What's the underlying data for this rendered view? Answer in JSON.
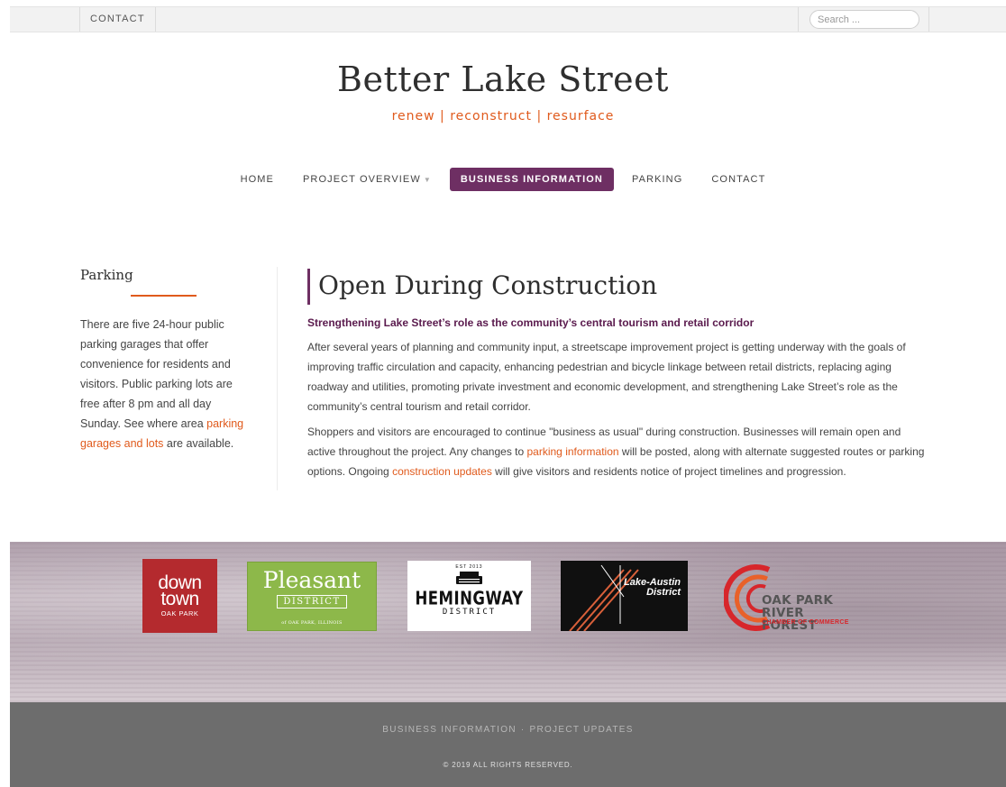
{
  "topbar": {
    "contact_label": "CONTACT",
    "search_placeholder": "Search ..."
  },
  "header": {
    "site_title": "Better Lake Street",
    "tagline": "renew | reconstruct | resurface"
  },
  "nav": {
    "items": [
      {
        "label": "HOME"
      },
      {
        "label": "PROJECT OVERVIEW"
      },
      {
        "label": "BUSINESS INFORMATION"
      },
      {
        "label": "PARKING"
      },
      {
        "label": "CONTACT"
      }
    ],
    "active": "BUSINESS INFORMATION",
    "dropdown_caret": "▼"
  },
  "sidebar": {
    "title": "Parking",
    "text": "There are five 24-hour public parking garages that offer convenience for residents and visitors. Public parking lots are free after 8 pm and all day Sunday. See where area ",
    "link_text": "parking garages and lots",
    "text_after": " are available."
  },
  "content": {
    "title": "Open During Construction",
    "subhead": "Strengthening Lake Street’s role as the community’s central tourism and retail corridor",
    "para1": "After several years of planning and community input, a streetscape improvement project is getting underway with the goals of improving traffic circulation and capacity, enhancing pedestrian and bicycle linkage between retail districts, replacing aging roadway and utilities, promoting private investment and economic development, and strengthening Lake Street’s role as the community’s central tourism and retail corridor.",
    "para2_a": "Shoppers and visitors are encouraged to continue \"business as usual\" during construction. Businesses will remain open and active throughout the project. Any changes to ",
    "para2_link1": "parking information",
    "para2_b": " will be posted, along with alternate suggested routes or parking options. Ongoing ",
    "para2_link2": "construction updates",
    "para2_c": " will give visitors and residents notice of project timelines and progression."
  },
  "logos": {
    "downtown": {
      "line1": "down",
      "line2": "town",
      "line3": "OAK PARK"
    },
    "pleasant": {
      "line1": "Pleasant",
      "line2": "DISTRICT",
      "line3": "of OAK PARK, ILLINOIS"
    },
    "hemingway": {
      "est": "EST   2013",
      "main": "HEMINGWAY",
      "sub": "DISTRICT"
    },
    "lake_austin": {
      "line1": "Lake-Austin",
      "line2": "District"
    },
    "oak_park": {
      "line1": "OAK PARK",
      "line2": "RIVER FOREST",
      "line3": "CHAMBER OF COMMERCE"
    }
  },
  "footer": {
    "links": [
      "BUSINESS INFORMATION",
      "PROJECT UPDATES"
    ],
    "separator": "·",
    "copyright": "© 2019 ALL RIGHTS RESERVED."
  },
  "colors": {
    "accent_orange": "#e05a1c",
    "accent_plum": "#6e2f63",
    "footer_gray": "#6d6d6d"
  }
}
